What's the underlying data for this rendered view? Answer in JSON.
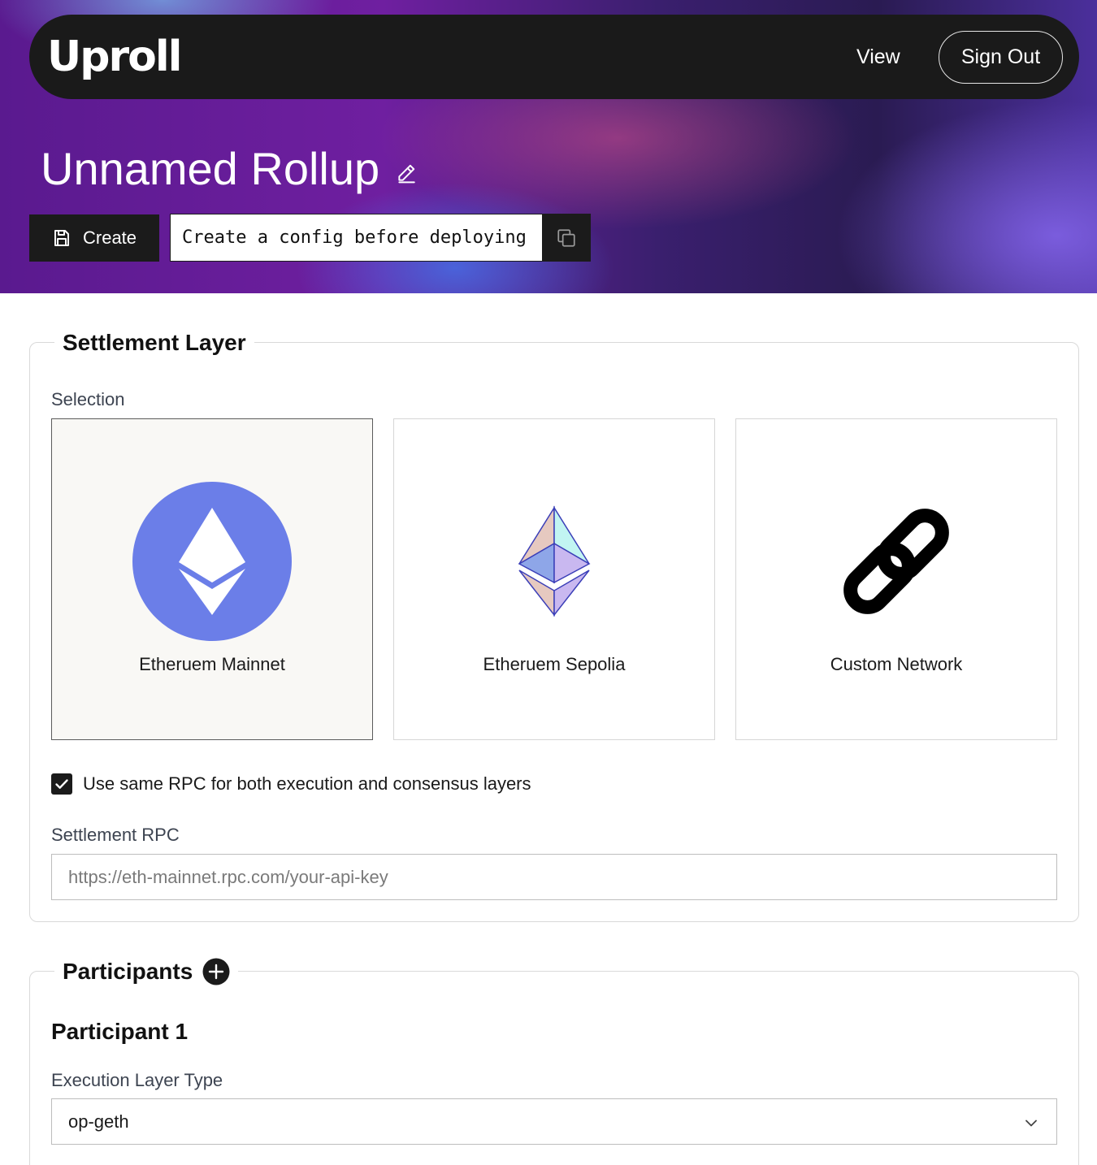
{
  "header": {
    "logo": "Uproll",
    "nav_view": "View",
    "nav_sign_out": "Sign Out"
  },
  "page": {
    "title": "Unnamed Rollup",
    "create_label": "Create",
    "config_message": "Create a config before deploying"
  },
  "settlement": {
    "heading": "Settlement Layer",
    "selection_label": "Selection",
    "options": [
      {
        "label": "Etheruem Mainnet",
        "icon": "ethereum-mainnet-icon",
        "selected": true
      },
      {
        "label": "Etheruem Sepolia",
        "icon": "ethereum-sepolia-icon",
        "selected": false
      },
      {
        "label": "Custom Network",
        "icon": "link-icon",
        "selected": false
      }
    ],
    "same_rpc_label": "Use same RPC for both execution and consensus layers",
    "same_rpc_checked": true,
    "rpc_label": "Settlement RPC",
    "rpc_placeholder": "https://eth-mainnet.rpc.com/your-api-key"
  },
  "participants": {
    "heading": "Participants",
    "participant_title": "Participant 1",
    "execution_label": "Execution Layer Type",
    "execution_value": "op-geth"
  },
  "colors": {
    "ethereum_blue": "#6b7ee8",
    "dark": "#1b1b1b"
  }
}
